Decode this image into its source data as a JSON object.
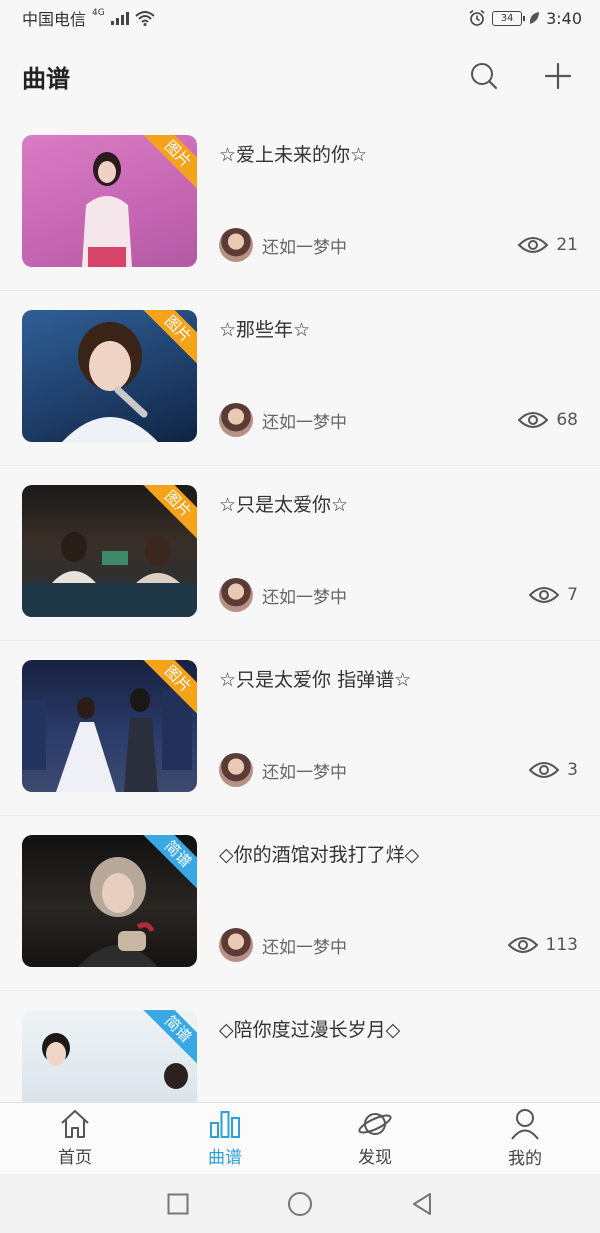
{
  "status_bar": {
    "carrier": "中国电信",
    "network": "4G",
    "battery": "34",
    "time": "3:40"
  },
  "header": {
    "title": "曲谱",
    "search_icon": "search-icon",
    "add_icon": "plus-icon"
  },
  "songs": [
    {
      "title": "☆爱上未来的你☆",
      "author": "还如一梦中",
      "views": "21",
      "tag": "图片",
      "tag_color": "#f5a31a"
    },
    {
      "title": "☆那些年☆",
      "author": "还如一梦中",
      "views": "68",
      "tag": "图片",
      "tag_color": "#f5a31a"
    },
    {
      "title": "☆只是太爱你☆",
      "author": "还如一梦中",
      "views": "7",
      "tag": "图片",
      "tag_color": "#f5a31a"
    },
    {
      "title": "☆只是太爱你 指弹谱☆",
      "author": "还如一梦中",
      "views": "3",
      "tag": "图片",
      "tag_color": "#f5a31a"
    },
    {
      "title": "◇你的酒馆对我打了烊◇",
      "author": "还如一梦中",
      "views": "113",
      "tag": "简谱",
      "tag_color": "#39a9e6"
    },
    {
      "title": "◇陪你度过漫长岁月◇",
      "author": "",
      "views": "",
      "tag": "简谱",
      "tag_color": "#39a9e6"
    }
  ],
  "bottom_nav": [
    {
      "label": "首页",
      "icon": "home-icon",
      "active": false
    },
    {
      "label": "曲谱",
      "icon": "chart-bars-icon",
      "active": true
    },
    {
      "label": "发现",
      "icon": "planet-icon",
      "active": false
    },
    {
      "label": "我的",
      "icon": "person-icon",
      "active": false
    }
  ],
  "colors": {
    "accent": "#2f9fd8",
    "tag_image": "#f5a31a",
    "tag_notation": "#39a9e6"
  }
}
